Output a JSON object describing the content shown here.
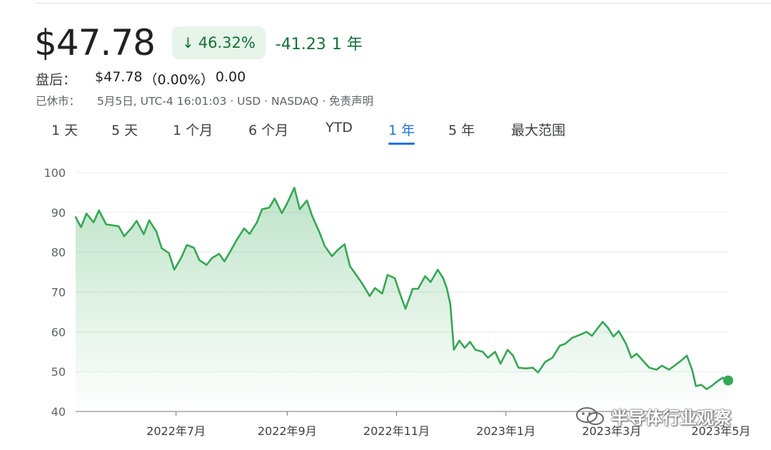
{
  "quote": {
    "price": "$47.78",
    "change_pct": "46.32%",
    "change_arrow": "↓",
    "change_abs": "-41.23",
    "change_period": "1 年",
    "after_hours_label": "盘后：",
    "after_hours_price": "$47.78",
    "after_hours_pct": "（0.00%）",
    "after_hours_abs": "0.00",
    "meta_status": "已休市：",
    "meta_info": "5月5日, UTC-4 16:01:03 · USD · NASDAQ · 免责声明"
  },
  "tabs": [
    {
      "label": "1 天"
    },
    {
      "label": "5 天"
    },
    {
      "label": "1 个月"
    },
    {
      "label": "6 个月"
    },
    {
      "label": "YTD"
    },
    {
      "label": "1 年",
      "active": true
    },
    {
      "label": "5 年"
    },
    {
      "label": "最大范围"
    }
  ],
  "colors": {
    "line": "#34a853",
    "positive_text": "#137333",
    "badge_bg": "#e6f4ea",
    "active_tab": "#1a73e8",
    "grid": "#ebebeb"
  },
  "watermark": {
    "text": "半导体行业观察",
    "icon": "wechat-icon"
  },
  "chart_data": {
    "type": "area",
    "title": "",
    "xlabel": "",
    "ylabel": "",
    "ylim": [
      40,
      100
    ],
    "yticks": [
      40,
      50,
      60,
      70,
      80,
      90,
      100
    ],
    "grid": true,
    "x_tick_labels": [
      "2022年7月",
      "2022年9月",
      "2022年11月",
      "2023年1月",
      "2023年3月",
      "2023年5月"
    ],
    "x_ticks": [
      "2022-07-01",
      "2022-09-01",
      "2022-11-01",
      "2023-01-01",
      "2023-03-01",
      "2023-05-01"
    ],
    "x_range": [
      "2022-05-06",
      "2023-05-05"
    ],
    "series": [
      {
        "values": [
          [
            "2022-05-06",
            88.8
          ],
          [
            "2022-05-09",
            86.3
          ],
          [
            "2022-05-12",
            89.7
          ],
          [
            "2022-05-16",
            87.5
          ],
          [
            "2022-05-19",
            90.5
          ],
          [
            "2022-05-23",
            87.0
          ],
          [
            "2022-05-26",
            86.8
          ],
          [
            "2022-05-30",
            86.5
          ],
          [
            "2022-06-02",
            84.0
          ],
          [
            "2022-06-06",
            86.0
          ],
          [
            "2022-06-09",
            87.9
          ],
          [
            "2022-06-13",
            84.5
          ],
          [
            "2022-06-16",
            88.0
          ],
          [
            "2022-06-20",
            85.2
          ],
          [
            "2022-06-23",
            81.0
          ],
          [
            "2022-06-27",
            79.8
          ],
          [
            "2022-06-30",
            75.6
          ],
          [
            "2022-07-04",
            78.7
          ],
          [
            "2022-07-07",
            81.8
          ],
          [
            "2022-07-11",
            81.1
          ],
          [
            "2022-07-14",
            78.0
          ],
          [
            "2022-07-18",
            76.8
          ],
          [
            "2022-07-21",
            78.5
          ],
          [
            "2022-07-25",
            79.6
          ],
          [
            "2022-07-28",
            77.7
          ],
          [
            "2022-08-01",
            80.8
          ],
          [
            "2022-08-04",
            83.2
          ],
          [
            "2022-08-08",
            86.0
          ],
          [
            "2022-08-11",
            84.6
          ],
          [
            "2022-08-15",
            87.4
          ],
          [
            "2022-08-18",
            90.8
          ],
          [
            "2022-08-22",
            91.2
          ],
          [
            "2022-08-25",
            93.5
          ],
          [
            "2022-08-29",
            89.8
          ],
          [
            "2022-09-01",
            92.3
          ],
          [
            "2022-09-05",
            96.2
          ],
          [
            "2022-09-08",
            90.8
          ],
          [
            "2022-09-12",
            93.0
          ],
          [
            "2022-09-15",
            89.0
          ],
          [
            "2022-09-19",
            85.0
          ],
          [
            "2022-09-22",
            81.5
          ],
          [
            "2022-09-26",
            79.0
          ],
          [
            "2022-09-29",
            80.5
          ],
          [
            "2022-10-03",
            82.0
          ],
          [
            "2022-10-06",
            76.5
          ],
          [
            "2022-10-10",
            74.0
          ],
          [
            "2022-10-13",
            72.0
          ],
          [
            "2022-10-17",
            69.0
          ],
          [
            "2022-10-20",
            71.0
          ],
          [
            "2022-10-24",
            69.6
          ],
          [
            "2022-10-27",
            74.3
          ],
          [
            "2022-10-31",
            73.5
          ],
          [
            "2022-11-03",
            69.5
          ],
          [
            "2022-11-06",
            65.8
          ],
          [
            "2022-11-10",
            70.8
          ],
          [
            "2022-11-13",
            70.8
          ],
          [
            "2022-11-17",
            74.0
          ],
          [
            "2022-11-20",
            72.5
          ],
          [
            "2022-11-24",
            75.6
          ],
          [
            "2022-11-27",
            73.5
          ],
          [
            "2022-11-29",
            71.0
          ],
          [
            "2022-12-01",
            67.0
          ],
          [
            "2022-12-03",
            55.5
          ],
          [
            "2022-12-06",
            57.8
          ],
          [
            "2022-12-09",
            56.0
          ],
          [
            "2022-12-12",
            57.5
          ],
          [
            "2022-12-15",
            55.5
          ],
          [
            "2022-12-19",
            55.0
          ],
          [
            "2022-12-22",
            53.5
          ],
          [
            "2022-12-26",
            55.0
          ],
          [
            "2022-12-29",
            52.0
          ],
          [
            "2023-01-02",
            55.5
          ],
          [
            "2023-01-05",
            54.0
          ],
          [
            "2023-01-08",
            51.0
          ],
          [
            "2023-01-12",
            50.8
          ],
          [
            "2023-01-16",
            51.0
          ],
          [
            "2023-01-19",
            49.8
          ],
          [
            "2023-01-23",
            52.5
          ],
          [
            "2023-01-27",
            53.5
          ],
          [
            "2023-01-31",
            56.5
          ],
          [
            "2023-02-03",
            57.0
          ],
          [
            "2023-02-07",
            58.5
          ],
          [
            "2023-02-11",
            59.2
          ],
          [
            "2023-02-15",
            60.0
          ],
          [
            "2023-02-18",
            59.0
          ],
          [
            "2023-02-21",
            60.8
          ],
          [
            "2023-02-24",
            62.5
          ],
          [
            "2023-02-27",
            61.0
          ],
          [
            "2023-03-02",
            58.8
          ],
          [
            "2023-03-05",
            60.2
          ],
          [
            "2023-03-09",
            57.0
          ],
          [
            "2023-03-12",
            53.5
          ],
          [
            "2023-03-15",
            54.5
          ],
          [
            "2023-03-19",
            52.5
          ],
          [
            "2023-03-22",
            51.0
          ],
          [
            "2023-03-26",
            50.5
          ],
          [
            "2023-03-29",
            51.5
          ],
          [
            "2023-04-02",
            50.5
          ],
          [
            "2023-04-05",
            51.5
          ],
          [
            "2023-04-08",
            52.5
          ],
          [
            "2023-04-12",
            54.0
          ],
          [
            "2023-04-15",
            50.3
          ],
          [
            "2023-04-17",
            46.4
          ],
          [
            "2023-04-20",
            46.7
          ],
          [
            "2023-04-23",
            45.6
          ],
          [
            "2023-04-26",
            46.5
          ],
          [
            "2023-04-29",
            47.6
          ],
          [
            "2023-05-02",
            48.5
          ],
          [
            "2023-05-04",
            47.4
          ],
          [
            "2023-05-05",
            47.78
          ]
        ]
      }
    ]
  }
}
